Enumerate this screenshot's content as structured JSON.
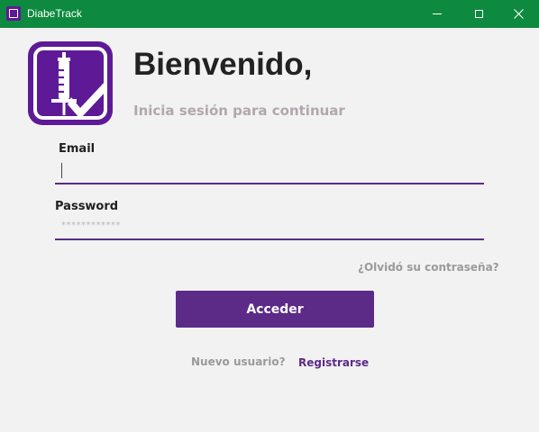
{
  "window": {
    "title": "DiabeTrack",
    "icon": "app-icon",
    "controls": [
      "minimize-icon",
      "maximize-icon",
      "close-icon"
    ]
  },
  "header": {
    "title": "Bienvenido,",
    "subtitle": "Inicia sesión para continuar",
    "logo_icon": "syringe-check-icon"
  },
  "form": {
    "email_label": "Email",
    "email_value": "",
    "password_label": "Password",
    "password_mask": "************",
    "forgot_link": "¿Olvidó su contraseña?",
    "submit_label": "Acceder"
  },
  "footer": {
    "new_user_text": "Nuevo usuario?",
    "register_link": "Registrarse"
  },
  "colors": {
    "titlebar": "#0d8a3f",
    "accent": "#5c2a87",
    "logo": "#5e1a96"
  }
}
